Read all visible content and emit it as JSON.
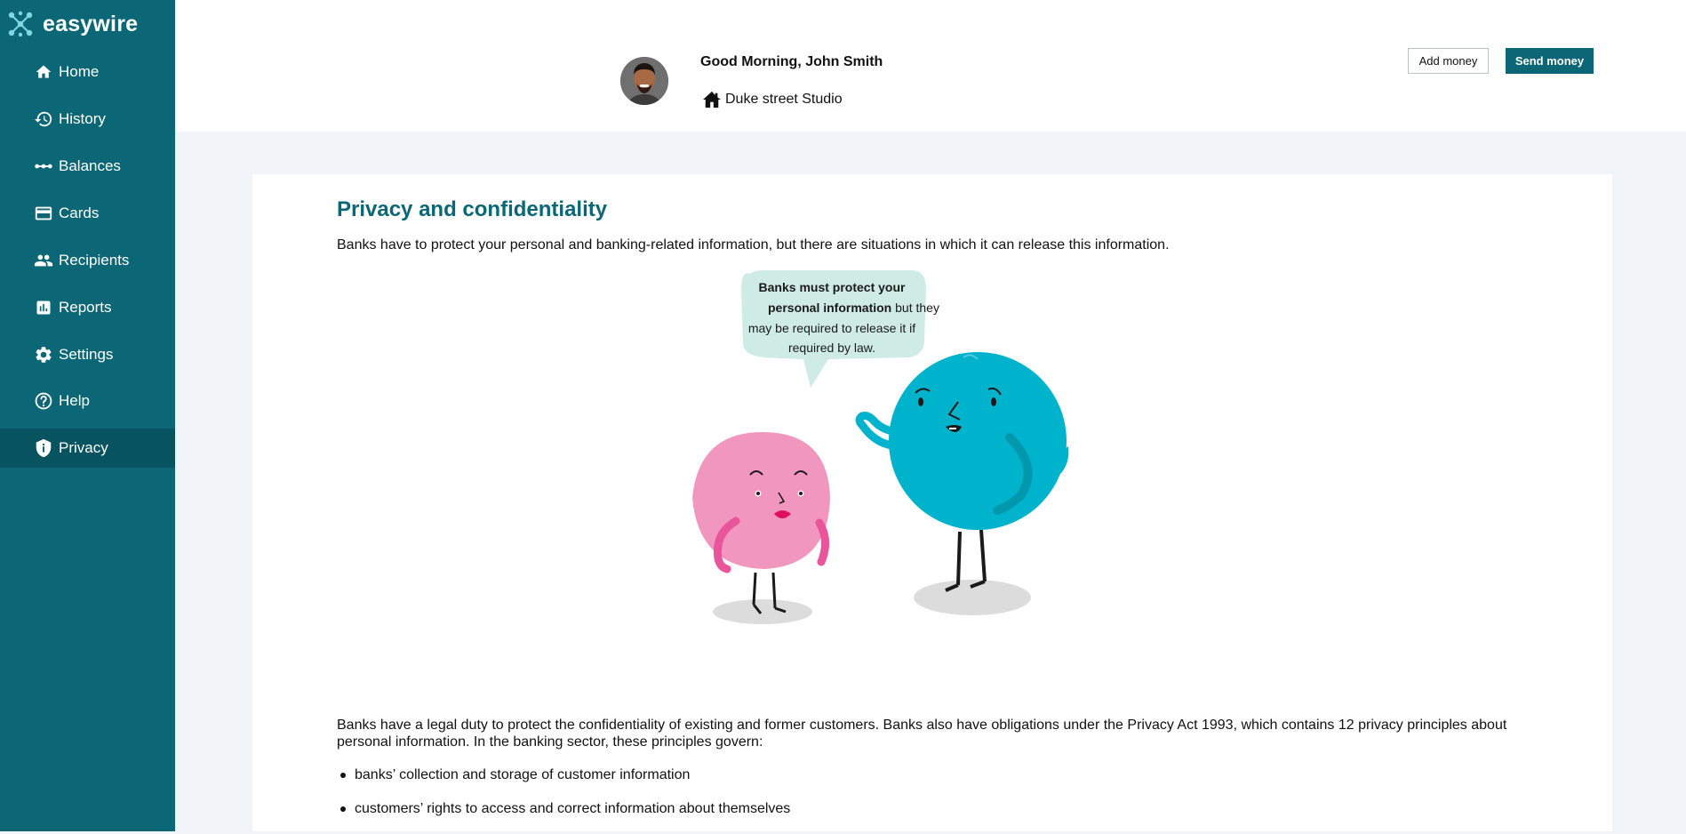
{
  "app": {
    "brand": "easywire"
  },
  "sidebar": {
    "items": [
      {
        "label": "Home",
        "icon": "home-icon"
      },
      {
        "label": "History",
        "icon": "history-icon"
      },
      {
        "label": "Balances",
        "icon": "balances-icon"
      },
      {
        "label": "Cards",
        "icon": "card-icon"
      },
      {
        "label": "Recipients",
        "icon": "people-icon"
      },
      {
        "label": "Reports",
        "icon": "chart-icon"
      },
      {
        "label": "Settings",
        "icon": "gear-icon"
      },
      {
        "label": "Help",
        "icon": "help-icon"
      },
      {
        "label": "Privacy",
        "icon": "shield-icon",
        "active": true
      }
    ]
  },
  "header": {
    "greeting": "Good Morning, John Smith",
    "location": "Duke street Studio",
    "add_money_label": "Add money",
    "send_money_label": "Send money"
  },
  "content": {
    "title": "Privacy and confidentiality",
    "intro": "Banks have to protect your personal and banking-related information, but there are situations in which it can release this information.",
    "bubble": {
      "bold": "Banks must protect your personal information",
      "rest": " but they may be required to release it if required by law."
    },
    "paragraph": "Banks have a legal duty to protect the confidentiality of existing and former customers. Banks also have obligations under the Privacy Act 1993, which contains 12 privacy principles about personal information. In the banking sector, these principles govern:",
    "bullets": [
      "banks’ collection and storage of customer information",
      "customers’ rights to access and correct information about themselves"
    ]
  },
  "colors": {
    "primary": "#0b6776",
    "primary_dark": "#085360",
    "title": "#0b6776",
    "background": "#f0f3f7"
  }
}
